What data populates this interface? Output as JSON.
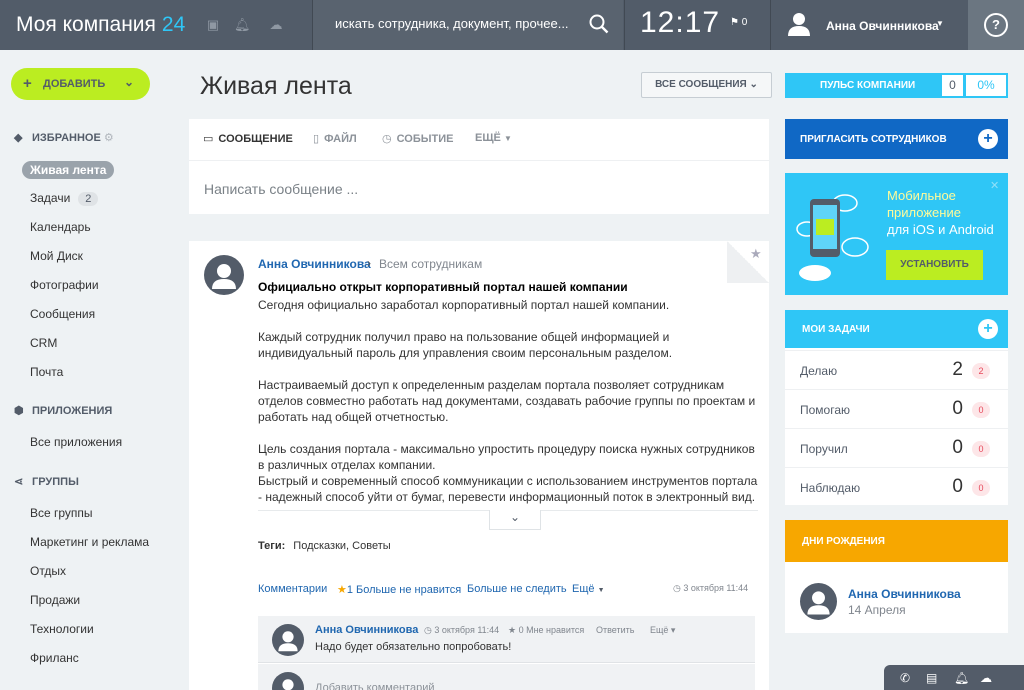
{
  "header": {
    "brand": "Моя компания",
    "brand_num": "24",
    "search_placeholder": "искать сотрудника, документ, прочее...",
    "clock": "12:17",
    "flag_count": "0",
    "user_name": "Анна Овчинникова",
    "help": "?"
  },
  "sidebar": {
    "add_label": "ДОБАВИТЬ",
    "favorites": "ИЗБРАННОЕ",
    "items": [
      {
        "label": "Живая лента"
      },
      {
        "label": "Задачи",
        "count": "2"
      },
      {
        "label": "Календарь"
      },
      {
        "label": "Мой Диск"
      },
      {
        "label": "Фотографии"
      },
      {
        "label": "Сообщения"
      },
      {
        "label": "CRM"
      },
      {
        "label": "Почта"
      }
    ],
    "apps": "ПРИЛОЖЕНИЯ",
    "all_apps": "Все приложения",
    "groups": "ГРУППЫ",
    "group_items": [
      "Все группы",
      "Маркетинг и реклама",
      "Отдых",
      "Продажи",
      "Технологии",
      "Фриланс"
    ]
  },
  "main": {
    "title": "Живая лента",
    "filter": "ВСЕ СООБЩЕНИЯ",
    "composer": {
      "tabs": [
        "СООБЩЕНИЕ",
        "ФАЙЛ",
        "СОБЫТИЕ",
        "ЕЩЁ"
      ],
      "placeholder": "Написать сообщение ..."
    },
    "post": {
      "author": "Анна Овчинникова",
      "dest": "Всем сотрудникам",
      "title": "Официально открыт корпоративный портал нашей компании",
      "p1": "Сегодня официально заработал корпоративный портал нашей компании.",
      "p2": "Каждый сотрудник получил право на пользование общей информацией и индивидуальный пароль для управления своим персональным разделом.",
      "p3": "Настраиваемый доступ к определенным разделам портала позволяет сотрудникам отделов совместно работать над документами, создавать рабочие группы по проектам и работать над общей отчетностью.",
      "p4": "Цель создания портала - максимально упростить процедуру поиска нужных сотрудников в различных отделах компании.",
      "p5": "Быстрый и современный способ коммуникации с использованием инструментов портала - надежный способ уйти от бумаг, перевести информационный поток в электронный вид.",
      "tags_label": "Теги:",
      "tags": "Подсказки, Советы",
      "actions": {
        "comments": "Комментарии",
        "like": "1 Больше не нравится",
        "unfollow": "Больше не следить",
        "more": "Ещё"
      },
      "date": "3 октября 11:44",
      "comment": {
        "author": "Анна Овчинникова",
        "date": "3 октября 11:44",
        "likes": "0 Мне нравится",
        "reply": "Ответить",
        "more": "Ещё",
        "text": "Надо будет обязательно попробовать!"
      },
      "add_comment": "Добавить комментарий"
    }
  },
  "right": {
    "pulse": {
      "label": "ПУЛЬС КОМПАНИИ",
      "value": "0",
      "percent": "0%"
    },
    "invite": "ПРИГЛАСИТЬ СОТРУДНИКОВ",
    "mobile": {
      "title1": "Мобильное приложение",
      "title2": "для iOS и Android",
      "button": "УСТАНОВИТЬ"
    },
    "tasks": {
      "title": "МОИ ЗАДАЧИ",
      "rows": [
        {
          "label": "Делаю",
          "count": "2",
          "badge": "2"
        },
        {
          "label": "Помогаю",
          "count": "0",
          "badge": "0"
        },
        {
          "label": "Поручил",
          "count": "0",
          "badge": "0"
        },
        {
          "label": "Наблюдаю",
          "count": "0",
          "badge": "0"
        }
      ]
    },
    "birthdays": {
      "title": "ДНИ РОЖДЕНИЯ",
      "name": "Анна Овчинникова",
      "date": "14 Апреля"
    }
  },
  "colors": {
    "accent": "#2fc6f6",
    "green": "#bbed21",
    "blue": "#1068c5",
    "orange": "#f7a700",
    "header": "#525c69"
  }
}
